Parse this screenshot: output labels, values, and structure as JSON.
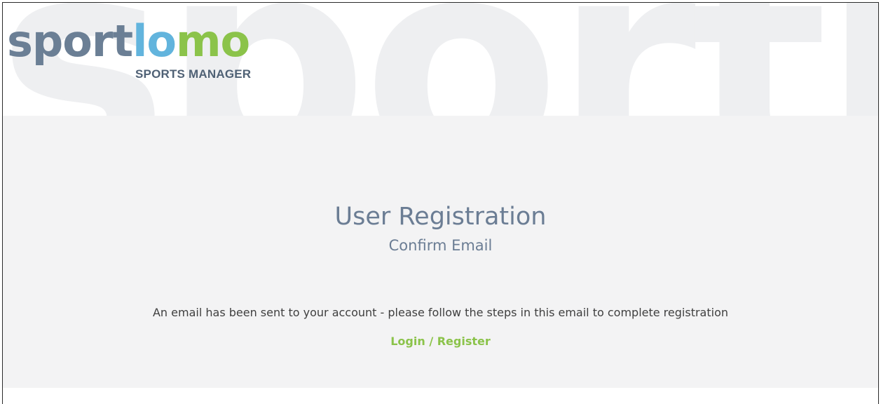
{
  "logo": {
    "part1": "sport",
    "part2": "lo",
    "part3": "mo",
    "tagline": "SPORTS MANAGER",
    "colors": {
      "slate": "#6b7f95",
      "blue": "#62b4dd",
      "green": "#8bc34a"
    }
  },
  "background_watermark": "sportlomo",
  "page": {
    "title": "User Registration",
    "subtitle": "Confirm Email",
    "message": "An email has been sent to your account - please follow the steps in this email to complete registration",
    "link_label": "Login / Register",
    "link_color": "#8bc34a",
    "heading_color": "#6b7d94",
    "band_color": "#f3f3f4"
  }
}
